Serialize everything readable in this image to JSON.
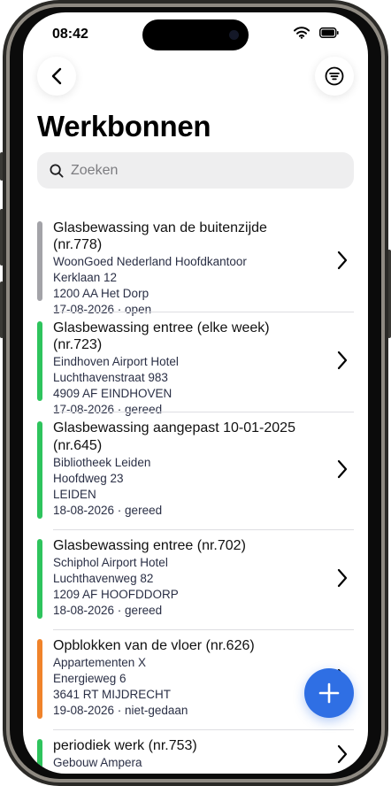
{
  "status_bar": {
    "time": "08:42"
  },
  "header": {
    "title": "Werkbonnen"
  },
  "search": {
    "placeholder": "Zoeken"
  },
  "colors": {
    "open": "#a3a3a8",
    "gereed": "#2ec45d",
    "niet_gedaan": "#f0832a",
    "accent": "#2f6fe4"
  },
  "items": [
    {
      "title": [
        "Glasbewassing van de buitenzijde (nr.778)"
      ],
      "lines": [
        "WoonGoed Nederland Hoofdkantoor",
        "Kerklaan 12",
        "1200 AA Het Dorp",
        "17-08-2026 · open"
      ],
      "status_color": "#a3a3a8"
    },
    {
      "title": [
        "Glasbewassing entree (elke week) (nr.723)"
      ],
      "lines": [
        "Eindhoven Airport Hotel",
        "Luchthavenstraat 983",
        "4909 AF EINDHOVEN",
        "17-08-2026 · gereed"
      ],
      "status_color": "#2ec45d"
    },
    {
      "title": [
        "Glasbewassing aangepast 10-01-2025",
        "(nr.645)"
      ],
      "lines": [
        "Bibliotheek Leiden",
        "Hoofdweg 23",
        "LEIDEN",
        "18-08-2026 · gereed"
      ],
      "status_color": "#2ec45d"
    },
    {
      "title": [
        "Glasbewassing entree (nr.702)"
      ],
      "lines": [
        "Schiphol Airport Hotel",
        "Luchthavenweg 82",
        "1209 AF HOOFDDORP",
        "18-08-2026 · gereed"
      ],
      "status_color": "#2ec45d"
    },
    {
      "title": [
        "Opblokken van de vloer (nr.626)"
      ],
      "lines": [
        "Appartementen X",
        "Energieweg 6",
        "3641 RT MIJDRECHT",
        "19-08-2026 · niet-gedaan"
      ],
      "status_color": "#f0832a"
    },
    {
      "title": [
        "periodiek werk (nr.753)"
      ],
      "lines": [
        "Gebouw Ampera"
      ],
      "status_color": "#2ec45d"
    }
  ]
}
